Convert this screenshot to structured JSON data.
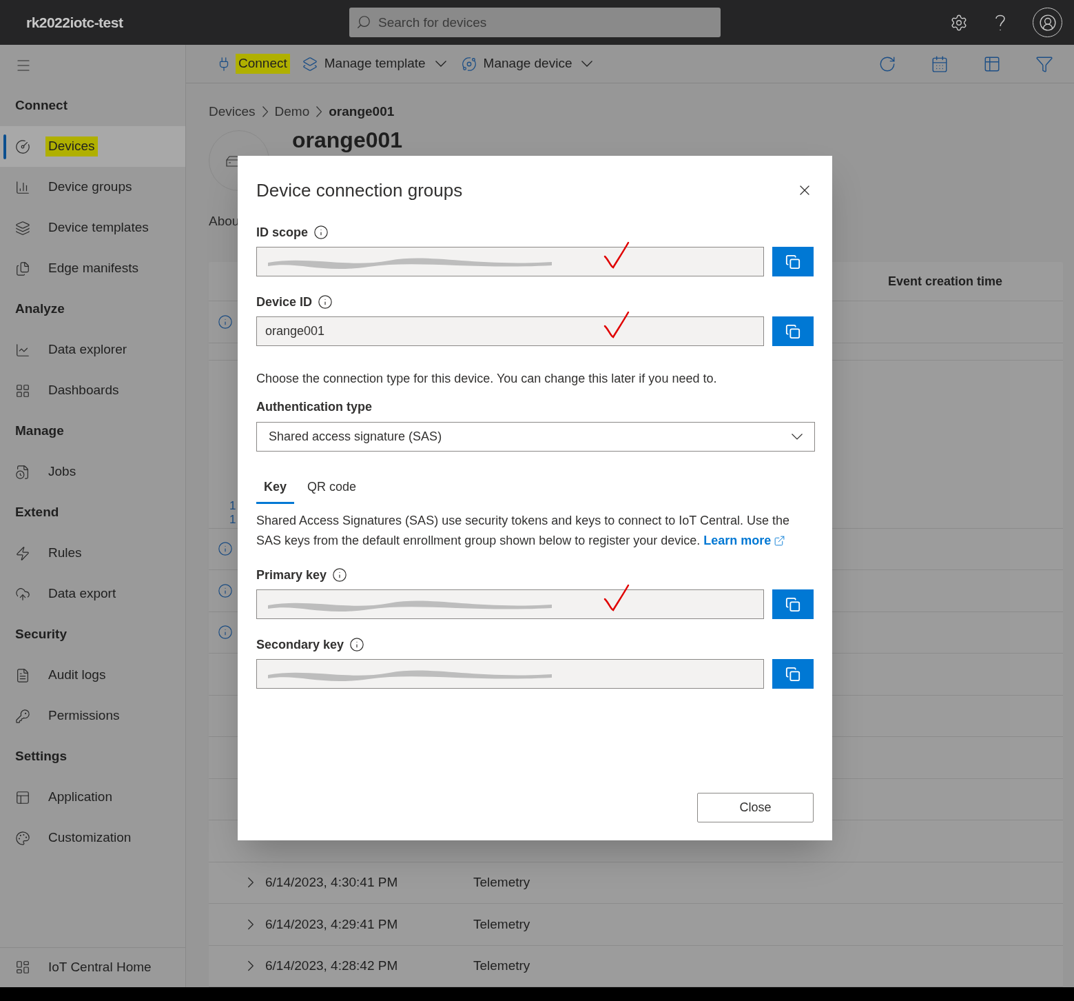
{
  "app": {
    "title": "rk2022iotc-test"
  },
  "search": {
    "placeholder": "Search for devices"
  },
  "sidebar": {
    "sections": [
      {
        "heading": "Connect",
        "items": [
          {
            "label": "Devices",
            "selected": true,
            "highlighted": true
          },
          {
            "label": "Device groups",
            "selected": false,
            "highlighted": false
          },
          {
            "label": "Device templates",
            "selected": false,
            "highlighted": false
          },
          {
            "label": "Edge manifests",
            "selected": false,
            "highlighted": false
          }
        ]
      },
      {
        "heading": "Analyze",
        "items": [
          {
            "label": "Data explorer",
            "selected": false,
            "highlighted": false
          },
          {
            "label": "Dashboards",
            "selected": false,
            "highlighted": false
          }
        ]
      },
      {
        "heading": "Manage",
        "items": [
          {
            "label": "Jobs",
            "selected": false,
            "highlighted": false
          }
        ]
      },
      {
        "heading": "Extend",
        "items": [
          {
            "label": "Rules",
            "selected": false,
            "highlighted": false
          },
          {
            "label": "Data export",
            "selected": false,
            "highlighted": false
          }
        ]
      },
      {
        "heading": "Security",
        "items": [
          {
            "label": "Audit logs",
            "selected": false,
            "highlighted": false
          },
          {
            "label": "Permissions",
            "selected": false,
            "highlighted": false
          }
        ]
      },
      {
        "heading": "Settings",
        "items": [
          {
            "label": "Application",
            "selected": false,
            "highlighted": false
          },
          {
            "label": "Customization",
            "selected": false,
            "highlighted": false
          }
        ]
      }
    ],
    "footer": {
      "label": "IoT Central Home"
    }
  },
  "toolbar": {
    "actions": [
      {
        "label": "Connect",
        "highlighted": true,
        "dropdown": false
      },
      {
        "label": "Manage template",
        "highlighted": false,
        "dropdown": true
      },
      {
        "label": "Manage device",
        "highlighted": false,
        "dropdown": true
      }
    ]
  },
  "breadcrumb": [
    {
      "label": "Devices",
      "current": false
    },
    {
      "label": "Demo",
      "current": false
    },
    {
      "label": "orange001",
      "current": true
    }
  ],
  "device": {
    "name": "orange001"
  },
  "page_tab": {
    "label": "Abou"
  },
  "table": {
    "columns": [
      "Event creation time"
    ],
    "partial_labels": [
      "1",
      "1"
    ],
    "rows": [
      {
        "kind": "info"
      },
      {
        "kind": "info"
      },
      {
        "kind": "info"
      },
      {
        "kind": "info"
      },
      {
        "kind": "blank"
      },
      {
        "kind": "blank"
      },
      {
        "kind": "blank"
      },
      {
        "kind": "blank"
      },
      {
        "kind": "blank"
      },
      {
        "kind": "event",
        "time": "6/14/2023, 4:30:41 PM",
        "type": "Telemetry"
      },
      {
        "kind": "event",
        "time": "6/14/2023, 4:29:41 PM",
        "type": "Telemetry"
      },
      {
        "kind": "event",
        "time": "6/14/2023, 4:28:42 PM",
        "type": "Telemetry"
      }
    ]
  },
  "dialog": {
    "title": "Device connection groups",
    "id_fields": [
      {
        "label": "ID scope",
        "redacted": true,
        "annotated": true
      },
      {
        "label": "Device ID",
        "value": "orange001",
        "redacted": false,
        "annotated": true
      }
    ],
    "intro": "Choose the connection type for this device. You can change this later if you need to.",
    "auth": {
      "label": "Authentication type",
      "value": "Shared access signature (SAS)"
    },
    "tabs": [
      {
        "label": "Key",
        "selected": true
      },
      {
        "label": "QR code",
        "selected": false
      }
    ],
    "description": "Shared Access Signatures (SAS) use security tokens and keys to connect to IoT Central. Use the SAS keys from the default enrollment group shown below to register your device.",
    "link": "Learn more",
    "key_fields": [
      {
        "label": "Primary key",
        "redacted": true,
        "annotated": true
      },
      {
        "label": "Secondary key",
        "redacted": true,
        "annotated": false
      }
    ],
    "close_button": "Close"
  }
}
